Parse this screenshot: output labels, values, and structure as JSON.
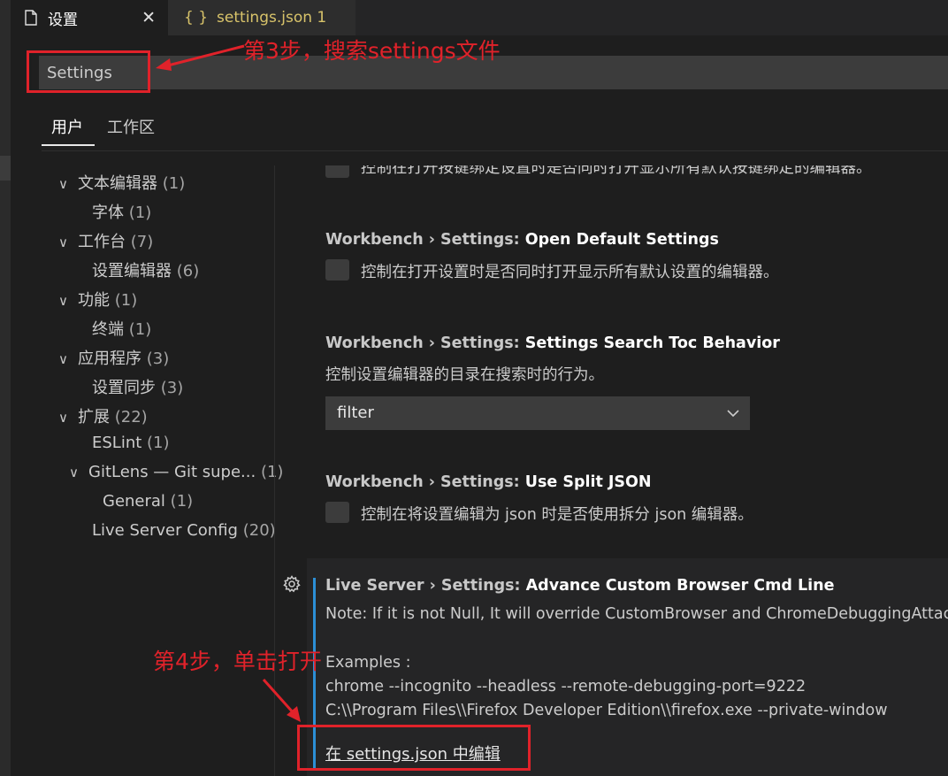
{
  "tabs": [
    {
      "label": "设置",
      "icon": "file-icon",
      "close": "✕"
    },
    {
      "label": "settings.json 1",
      "icon": "braces-icon",
      "icon_text": "{ }"
    }
  ],
  "search": {
    "value": "Settings"
  },
  "scopes": {
    "user": "用户",
    "workspace": "工作区"
  },
  "toc": [
    {
      "label": "文本编辑器",
      "count": "(1)"
    },
    {
      "label": "字体",
      "count": "(1)"
    },
    {
      "label": "工作台",
      "count": "(7)"
    },
    {
      "label": "设置编辑器",
      "count": "(6)"
    },
    {
      "label": "功能",
      "count": "(1)"
    },
    {
      "label": "终端",
      "count": "(1)"
    },
    {
      "label": "应用程序",
      "count": "(3)"
    },
    {
      "label": "设置同步",
      "count": "(3)"
    },
    {
      "label": "扩展",
      "count": "(22)"
    },
    {
      "label": "ESLint",
      "count": "(1)"
    },
    {
      "label": "GitLens — Git supe...",
      "count": "(1)"
    },
    {
      "label": "General",
      "count": "(1)"
    },
    {
      "label": "Live Server Config",
      "count": "(20)"
    }
  ],
  "settings": {
    "partial_desc": "控制在打开按键绑定设置时是否同时打开显示所有默认按键绑定的编辑器。",
    "open_default": {
      "category": "Workbench › Settings: ",
      "name": "Open Default Settings",
      "desc": "控制在打开设置时是否同时打开显示所有默认设置的编辑器。"
    },
    "search_toc": {
      "category": "Workbench › Settings: ",
      "name": "Settings Search Toc Behavior",
      "desc": "控制设置编辑器的目录在搜索时的行为。",
      "value": "filter"
    },
    "split_json": {
      "category": "Workbench › Settings: ",
      "name": "Use Split JSON",
      "desc": "控制在将设置编辑为 json 时是否使用拆分 json 编辑器。"
    },
    "live_server": {
      "category": "Live Server › Settings: ",
      "name": "Advance Custom Browser Cmd Line",
      "note": "Note: If it is not Null, It will override CustomBrowser and ChromeDebuggingAttach",
      "examples_label": "Examples :",
      "example1": "chrome --incognito --headless --remote-debugging-port=9222",
      "example2": "C:\\\\Program Files\\\\Firefox Developer Edition\\\\firefox.exe --private-window",
      "link": "在 settings.json 中编辑"
    }
  },
  "annotations": {
    "step3": "第3步，搜索settings文件",
    "step4": "第4步，单击打开"
  },
  "colors": {
    "accent": "#2c8fd6",
    "annotation": "#e0222a",
    "json_tab": "#d8c36a"
  }
}
